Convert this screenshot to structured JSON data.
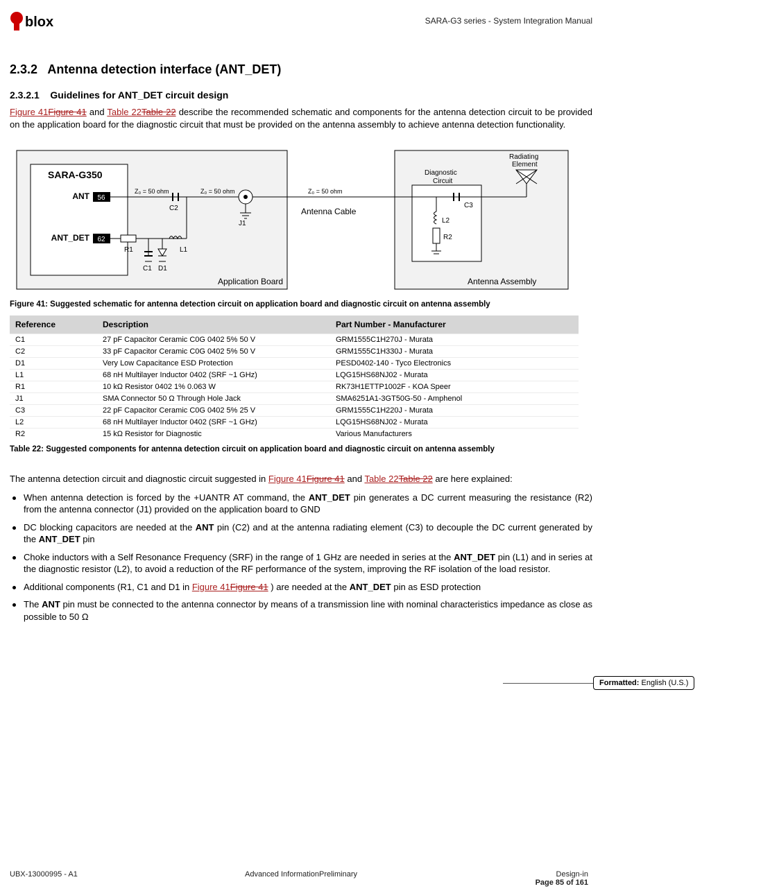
{
  "header": {
    "doc_title": "SARA-G3 series - System Integration Manual"
  },
  "section": {
    "h2_num": "2.3.2",
    "h2_title": "Antenna detection interface (ANT_DET)",
    "h3_num": "2.3.2.1",
    "h3_title": "Guidelines for ANT_DET circuit design"
  },
  "intro_para": {
    "ref1a": "Figure 41",
    "ref1b": "Figure 41",
    "mid1": " and ",
    "ref2a": "Table 22",
    "ref2b": "Table 22",
    "rest": " describe the recommended schematic and components for the antenna detection circuit to be provided on the application board for the diagnostic circuit that must be provided on the antenna assembly to achieve antenna detection functionality."
  },
  "schematic": {
    "module": "SARA-G350",
    "ant": "ANT",
    "ant_pin": "56",
    "ant_det": "ANT_DET",
    "ant_det_pin": "62",
    "z0": "Z₀ = 50 ohm",
    "c2": "C2",
    "j1": "J1",
    "r1": "R1",
    "l1": "L1",
    "c1": "C1",
    "d1": "D1",
    "app_board": "Application Board",
    "cable": "Antenna Cable",
    "diag": "Diagnostic Circuit",
    "rad": "Radiating Element",
    "c3": "C3",
    "l2": "L2",
    "r2": "R2",
    "antenna_assembly": "Antenna Assembly"
  },
  "figure_caption": "Figure 41: Suggested schematic for antenna detection circuit on application board and diagnostic circuit on antenna assembly",
  "table": {
    "headers": {
      "ref": "Reference",
      "desc": "Description",
      "pn": "Part Number - Manufacturer"
    },
    "rows": [
      {
        "ref": "C1",
        "desc": "27 pF Capacitor Ceramic C0G 0402 5% 50 V",
        "pn": "GRM1555C1H270J - Murata"
      },
      {
        "ref": "C2",
        "desc": "33 pF Capacitor Ceramic C0G 0402 5% 50 V",
        "pn": "GRM1555C1H330J - Murata"
      },
      {
        "ref": "D1",
        "desc": "Very Low Capacitance ESD Protection",
        "pn": "PESD0402-140 - Tyco Electronics"
      },
      {
        "ref": "L1",
        "desc": "68 nH Multilayer Inductor 0402 (SRF ~1 GHz)",
        "pn": "LQG15HS68NJ02 - Murata"
      },
      {
        "ref": "R1",
        "desc": "10 kΩ Resistor 0402 1% 0.063 W",
        "pn": "RK73H1ETTP1002F - KOA Speer"
      },
      {
        "ref": "J1",
        "desc": "SMA Connector 50 Ω Through Hole Jack",
        "pn": "SMA6251A1-3GT50G-50 - Amphenol"
      },
      {
        "ref": "C3",
        "desc": "22 pF Capacitor Ceramic C0G 0402 5% 25 V",
        "pn": "GRM1555C1H220J - Murata"
      },
      {
        "ref": "L2",
        "desc": "68 nH Multilayer Inductor 0402 (SRF ~1 GHz)",
        "pn": "LQG15HS68NJ02 - Murata"
      },
      {
        "ref": "R2",
        "desc": "15 kΩ Resistor for Diagnostic",
        "pn": "Various Manufacturers"
      }
    ]
  },
  "table_caption": "Table 22: Suggested components for antenna detection circuit on application board and diagnostic circuit on antenna assembly",
  "para2": {
    "pre": "The antenna detection circuit and diagnostic circuit suggested in ",
    "ref1a": "Figure 41",
    "ref1b": "Figure 41",
    "mid": " and ",
    "ref2a": "Table 22",
    "ref2b": "Table 22",
    "post": " are here explained:"
  },
  "bullets": [
    {
      "pre": "When antenna detection is forced by the +UANTR AT command, the ",
      "b1": "ANT_DET",
      "post": " pin generates a DC current measuring the resistance (R2) from the antenna connector (J1) provided on the application board to GND"
    },
    {
      "pre": "DC blocking capacitors are needed at the ",
      "b1": "ANT",
      "mid": " pin (C2) and at the antenna radiating element (C3) to decouple the DC current generated by the ",
      "b2": "ANT_DET",
      "post": " pin"
    },
    {
      "pre": "Choke inductors with a Self Resonance Frequency (SRF) in the range of 1 GHz are needed in series at the ",
      "b1": "ANT_DET",
      "post": " pin (L1) and in series at the diagnostic resistor (L2), to avoid a reduction of the RF performance of the system, improving the RF isolation of the load resistor."
    },
    {
      "pre": "Additional components (R1, C1 and D1 in ",
      "link_a": "Figure 41",
      "link_b": "Figure 41",
      "mid": ") are needed at the ",
      "b1": "ANT_DET",
      "post": " pin as ESD protection"
    },
    {
      "pre": "The ",
      "b1": "ANT",
      "post": " pin must be connected to the antenna connector by means of a transmission line with nominal characteristics impedance as close as possible to 50 Ω"
    }
  ],
  "comment": {
    "label": "Formatted:",
    "value": "English (U.S.)"
  },
  "footer": {
    "left": "UBX-13000995 - A1",
    "center": "Advanced InformationPreliminary",
    "right_line1": "Design-in",
    "right_line2": "Page 85 of 161"
  }
}
